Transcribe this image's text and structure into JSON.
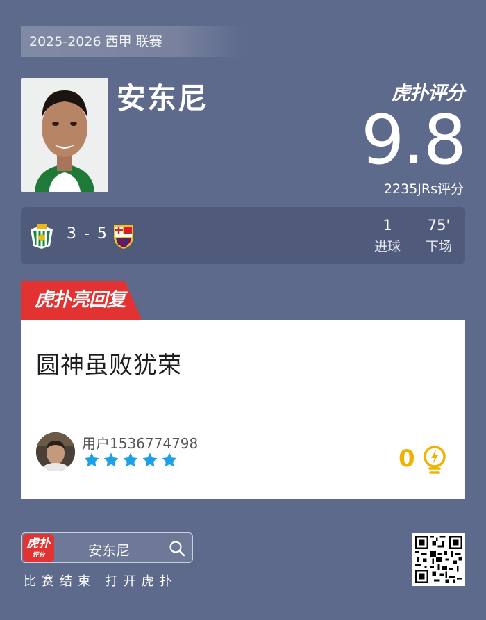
{
  "season": "2025-2026 西甲 联赛",
  "player": {
    "name": "安东尼",
    "photo_icon": "player-headshot"
  },
  "brand": {
    "logo_text": "虎扑评分"
  },
  "rating": {
    "value": "9.8",
    "count_label": "2235JRs评分"
  },
  "match": {
    "home_badge": "real-betis-badge-icon",
    "away_badge": "fc-barcelona-badge-icon",
    "score": "3 - 5",
    "stats": [
      {
        "value": "1",
        "label": "进球"
      },
      {
        "value": "75'",
        "label": "下场"
      }
    ]
  },
  "replies_tag": "虎扑亮回复",
  "reply": {
    "text": "圆神虽败犹荣",
    "username": "用户1536774798",
    "stars": 5,
    "likes": "0"
  },
  "footer": {
    "app_icon_big": "虎扑",
    "app_icon_small": "评分",
    "search_text": "安东尼",
    "cta_text": "比赛结束 打开虎扑"
  },
  "colors": {
    "background": "#5e6a8c",
    "accent_red": "#e23232",
    "star_blue": "#1ea0e8",
    "like_yellow": "#f2b100"
  }
}
